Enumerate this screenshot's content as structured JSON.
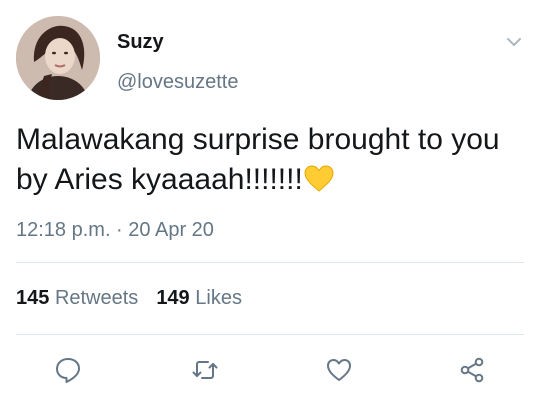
{
  "user": {
    "display_name": "Suzy",
    "handle": "@lovesuzette",
    "avatar_icon": "profile-photo"
  },
  "tweet": {
    "text": "Malawakang surprise brought to you by Aries kyaaaah!!!!!!!",
    "emoji": "yellow-heart",
    "timestamp": "12:18 p.m. · 20 Apr 20"
  },
  "stats": {
    "retweets_count": "145",
    "retweets_label": "Retweets",
    "likes_count": "149",
    "likes_label": "Likes"
  },
  "actions": [
    {
      "name": "reply",
      "icon": "comment-icon"
    },
    {
      "name": "retweet",
      "icon": "retweet-icon"
    },
    {
      "name": "like",
      "icon": "heart-icon"
    },
    {
      "name": "share",
      "icon": "share-icon"
    }
  ],
  "colors": {
    "text": "#14171a",
    "secondary": "#657786",
    "divider": "#e1e8ed",
    "emoji_yellow": "#ffcc33"
  }
}
